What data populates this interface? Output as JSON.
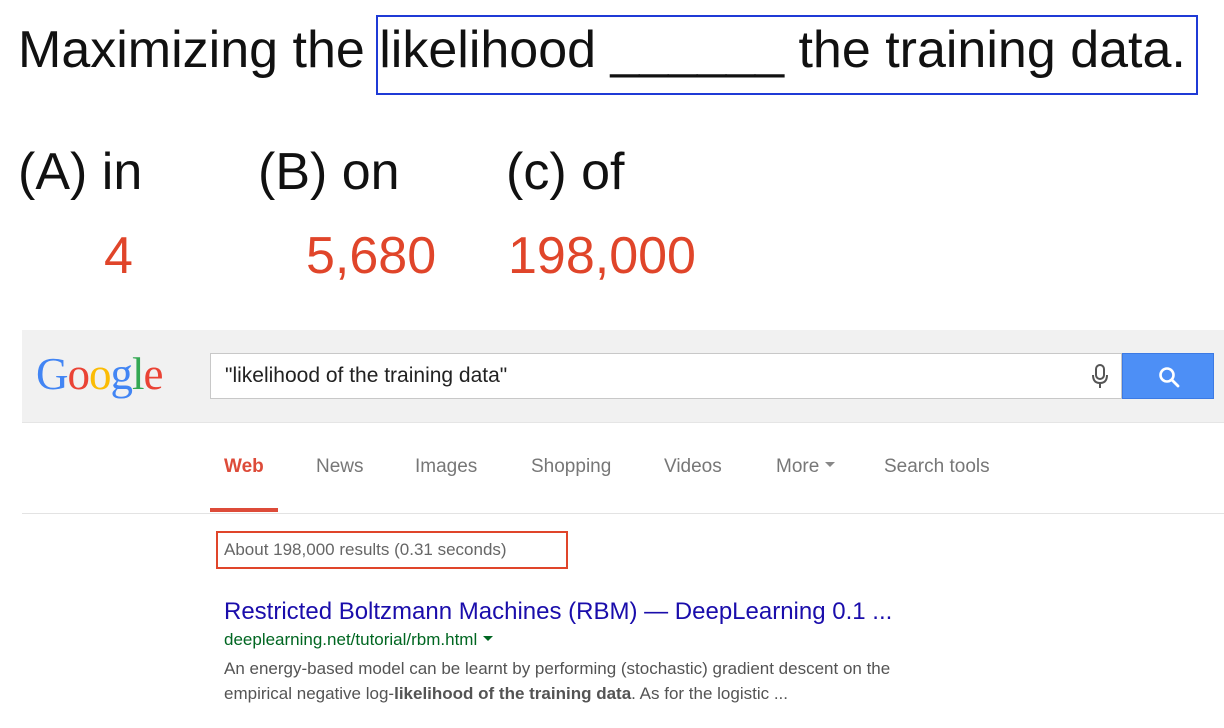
{
  "slide": {
    "question_prefix": "Maximizing the ",
    "question_phrase": "likelihood ______ the training data",
    "question_end": ".",
    "options": [
      {
        "label": "(A) in",
        "count": "4"
      },
      {
        "label": "(B) on",
        "count": "5,680"
      },
      {
        "label": "(c) of",
        "count": "198,000"
      }
    ],
    "accent_color": "#e0452a",
    "box_color": "#1f3ad6"
  },
  "google": {
    "logo_letters": [
      {
        "ch": "G",
        "color": "#4285f4"
      },
      {
        "ch": "o",
        "color": "#ea4335"
      },
      {
        "ch": "o",
        "color": "#fbbc05"
      },
      {
        "ch": "g",
        "color": "#4285f4"
      },
      {
        "ch": "l",
        "color": "#34a853"
      },
      {
        "ch": "e",
        "color": "#ea4335"
      }
    ],
    "search_value": "\"likelihood of the training data\"",
    "icons": {
      "mic": "microphone-icon",
      "search": "search-icon"
    },
    "tabs": [
      "Web",
      "News",
      "Images",
      "Shopping",
      "Videos",
      "More",
      "Search tools"
    ],
    "active_tab": "Web",
    "result_stats": "About 198,000 results (0.31 seconds)",
    "result": {
      "title": "Restricted Boltzmann Machines (RBM) — DeepLearning 0.1 ...",
      "url": "deeplearning.net/tutorial/rbm.html",
      "snippet_line1": "An energy-based model can be learnt by performing (stochastic) gradient descent on the",
      "snippet_line2_pre": "empirical negative log-",
      "snippet_line2_bold": "likelihood of the training data",
      "snippet_line2_post": ". As for the logistic ..."
    }
  }
}
